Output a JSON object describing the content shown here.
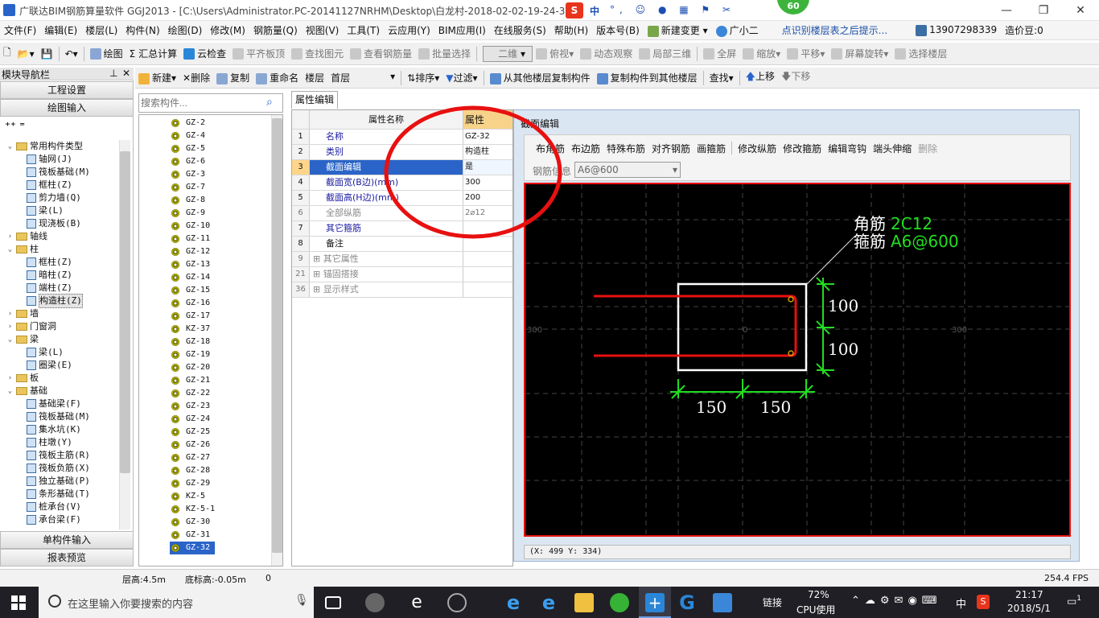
{
  "title_bar": {
    "text": "广联达BIM钢筋算量软件 GGJ2013 - [C:\\Users\\Administrator.PC-20141127NRHM\\Desktop\\白龙村-2018-02-02-19-24-35",
    "badge": "60",
    "ime": "中"
  },
  "menu": [
    "文件(F)",
    "编辑(E)",
    "楼层(L)",
    "构件(N)",
    "绘图(D)",
    "修改(M)",
    "钢筋量(Q)",
    "视图(V)",
    "工具(T)",
    "云应用(Y)",
    "BIM应用(I)",
    "在线服务(S)",
    "帮助(H)",
    "版本号(B)",
    "新建变更",
    "广小二",
    "点识别楼层表之后提示...",
    "13907298339",
    "造价豆:0"
  ],
  "toolbar1": [
    "绘图",
    "汇总计算",
    "云检查",
    "平齐板顶",
    "查找图元",
    "查看钢筋量",
    "批量选择",
    "二维",
    "俯视",
    "动态观察",
    "局部三维",
    "全屏",
    "缩放",
    "平移",
    "屏幕旋转",
    "选择楼层"
  ],
  "toolbar2": [
    "新建",
    "删除",
    "复制",
    "重命名",
    "楼层",
    "首层",
    "排序",
    "过滤",
    "从其他楼层复制构件",
    "复制构件到其他楼层",
    "查找",
    "上移",
    "下移"
  ],
  "nav": {
    "header": "模块导航栏",
    "btn_project": "工程设置",
    "btn_draw": "绘图输入",
    "btn_single": "单构件输入",
    "btn_report": "报表预览",
    "tree": [
      {
        "lvl": 0,
        "exp": "⌄",
        "type": "fold",
        "label": "常用构件类型"
      },
      {
        "lvl": 1,
        "type": "comp",
        "label": "轴网(J)"
      },
      {
        "lvl": 1,
        "type": "comp",
        "label": "筏板基础(M)"
      },
      {
        "lvl": 1,
        "type": "comp",
        "label": "框柱(Z)"
      },
      {
        "lvl": 1,
        "type": "comp",
        "label": "剪力墙(Q)"
      },
      {
        "lvl": 1,
        "type": "comp",
        "label": "梁(L)"
      },
      {
        "lvl": 1,
        "type": "comp",
        "label": "现浇板(B)"
      },
      {
        "lvl": 0,
        "exp": "›",
        "type": "fold",
        "label": "轴线"
      },
      {
        "lvl": 0,
        "exp": "⌄",
        "type": "fold",
        "label": "柱"
      },
      {
        "lvl": 1,
        "type": "comp",
        "label": "框柱(Z)"
      },
      {
        "lvl": 1,
        "type": "comp",
        "label": "暗柱(Z)"
      },
      {
        "lvl": 1,
        "type": "comp",
        "label": "端柱(Z)"
      },
      {
        "lvl": 1,
        "type": "comp",
        "label": "构造柱(Z)",
        "sel": true
      },
      {
        "lvl": 0,
        "exp": "›",
        "type": "fold",
        "label": "墙"
      },
      {
        "lvl": 0,
        "exp": "›",
        "type": "fold",
        "label": "门窗洞"
      },
      {
        "lvl": 0,
        "exp": "⌄",
        "type": "fold",
        "label": "梁"
      },
      {
        "lvl": 1,
        "type": "comp",
        "label": "梁(L)"
      },
      {
        "lvl": 1,
        "type": "comp",
        "label": "圈梁(E)"
      },
      {
        "lvl": 0,
        "exp": "›",
        "type": "fold",
        "label": "板"
      },
      {
        "lvl": 0,
        "exp": "⌄",
        "type": "fold",
        "label": "基础"
      },
      {
        "lvl": 1,
        "type": "comp",
        "label": "基础梁(F)"
      },
      {
        "lvl": 1,
        "type": "comp",
        "label": "筏板基础(M)"
      },
      {
        "lvl": 1,
        "type": "comp",
        "label": "集水坑(K)"
      },
      {
        "lvl": 1,
        "type": "comp",
        "label": "柱墩(Y)"
      },
      {
        "lvl": 1,
        "type": "comp",
        "label": "筏板主筋(R)"
      },
      {
        "lvl": 1,
        "type": "comp",
        "label": "筏板负筋(X)"
      },
      {
        "lvl": 1,
        "type": "comp",
        "label": "独立基础(P)"
      },
      {
        "lvl": 1,
        "type": "comp",
        "label": "条形基础(T)"
      },
      {
        "lvl": 1,
        "type": "comp",
        "label": "桩承台(V)"
      },
      {
        "lvl": 1,
        "type": "comp",
        "label": "承台梁(F)"
      }
    ]
  },
  "search_placeholder": "搜索构件...",
  "component_list": [
    "GZ-2",
    "GZ-4",
    "GZ-5",
    "GZ-6",
    "GZ-3",
    "GZ-7",
    "GZ-8",
    "GZ-9",
    "GZ-10",
    "GZ-11",
    "GZ-12",
    "GZ-13",
    "GZ-14",
    "GZ-15",
    "GZ-16",
    "GZ-17",
    "KZ-37",
    "GZ-18",
    "GZ-19",
    "GZ-20",
    "GZ-21",
    "GZ-22",
    "GZ-23",
    "GZ-24",
    "GZ-25",
    "GZ-26",
    "GZ-27",
    "GZ-28",
    "GZ-29",
    "KZ-5",
    "KZ-5-1",
    "GZ-30",
    "GZ-31",
    "GZ-32"
  ],
  "selected_component": "GZ-32",
  "prop_tab": "属性编辑",
  "prop_header": {
    "name": "属性名称",
    "value": "属性"
  },
  "props": [
    {
      "n": "1",
      "k": "名称",
      "v": "GZ-32"
    },
    {
      "n": "2",
      "k": "类别",
      "v": "构造柱"
    },
    {
      "n": "3",
      "k": "截面编辑",
      "v": "是",
      "sel": true
    },
    {
      "n": "4",
      "k": "截面宽(B边)(mm)",
      "v": "300"
    },
    {
      "n": "5",
      "k": "截面高(H边)(mm)",
      "v": "200"
    },
    {
      "n": "6",
      "k": "全部纵筋",
      "v": "2⌀12",
      "grey": true
    },
    {
      "n": "7",
      "k": "其它箍筋",
      "v": ""
    },
    {
      "n": "8",
      "k": "备注",
      "v": "",
      "black": true
    },
    {
      "n": "9",
      "k": "其它属性",
      "v": "",
      "plus": true,
      "grey": true
    },
    {
      "n": "21",
      "k": "锚固搭接",
      "v": "",
      "plus": true,
      "grey": true
    },
    {
      "n": "36",
      "k": "显示样式",
      "v": "",
      "plus": true,
      "grey": true
    }
  ],
  "section_editor": {
    "title": "截面编辑",
    "tools": [
      "布角筋",
      "布边筋",
      "特殊布筋",
      "对齐钢筋",
      "画箍筋",
      "修改纵筋",
      "修改箍筋",
      "编辑弯钩",
      "端头伸缩",
      "删除"
    ],
    "rebar_label": "钢筋信息",
    "rebar_value": "A6@600",
    "label_corner": "角筋",
    "label_corner_val": "2C12",
    "label_stirrup": "箍筋",
    "label_stirrup_val": "A6@600",
    "dim_v1": "100",
    "dim_v2": "100",
    "dim_h1": "150",
    "dim_h2": "150",
    "axis_left": "300",
    "axis_mid": "0",
    "axis_right": "300",
    "coords": "(X: 499 Y: 334)"
  },
  "status": {
    "floor_height": "层高:4.5m",
    "base_height": "底标高:-0.05m",
    "zero": "0",
    "fps": "254.4 FPS"
  },
  "taskbar": {
    "search": "在这里输入你要搜索的内容",
    "cpu": "72%",
    "cpu_label": "CPU使用",
    "link": "链接",
    "lang": "中",
    "time": "21:17",
    "date": "2018/5/1",
    "notif": "1"
  },
  "colors": {
    "accent": "#2a64c8",
    "canvas": "#000000",
    "rebar": "#e81010",
    "dim": "#22dd22"
  }
}
